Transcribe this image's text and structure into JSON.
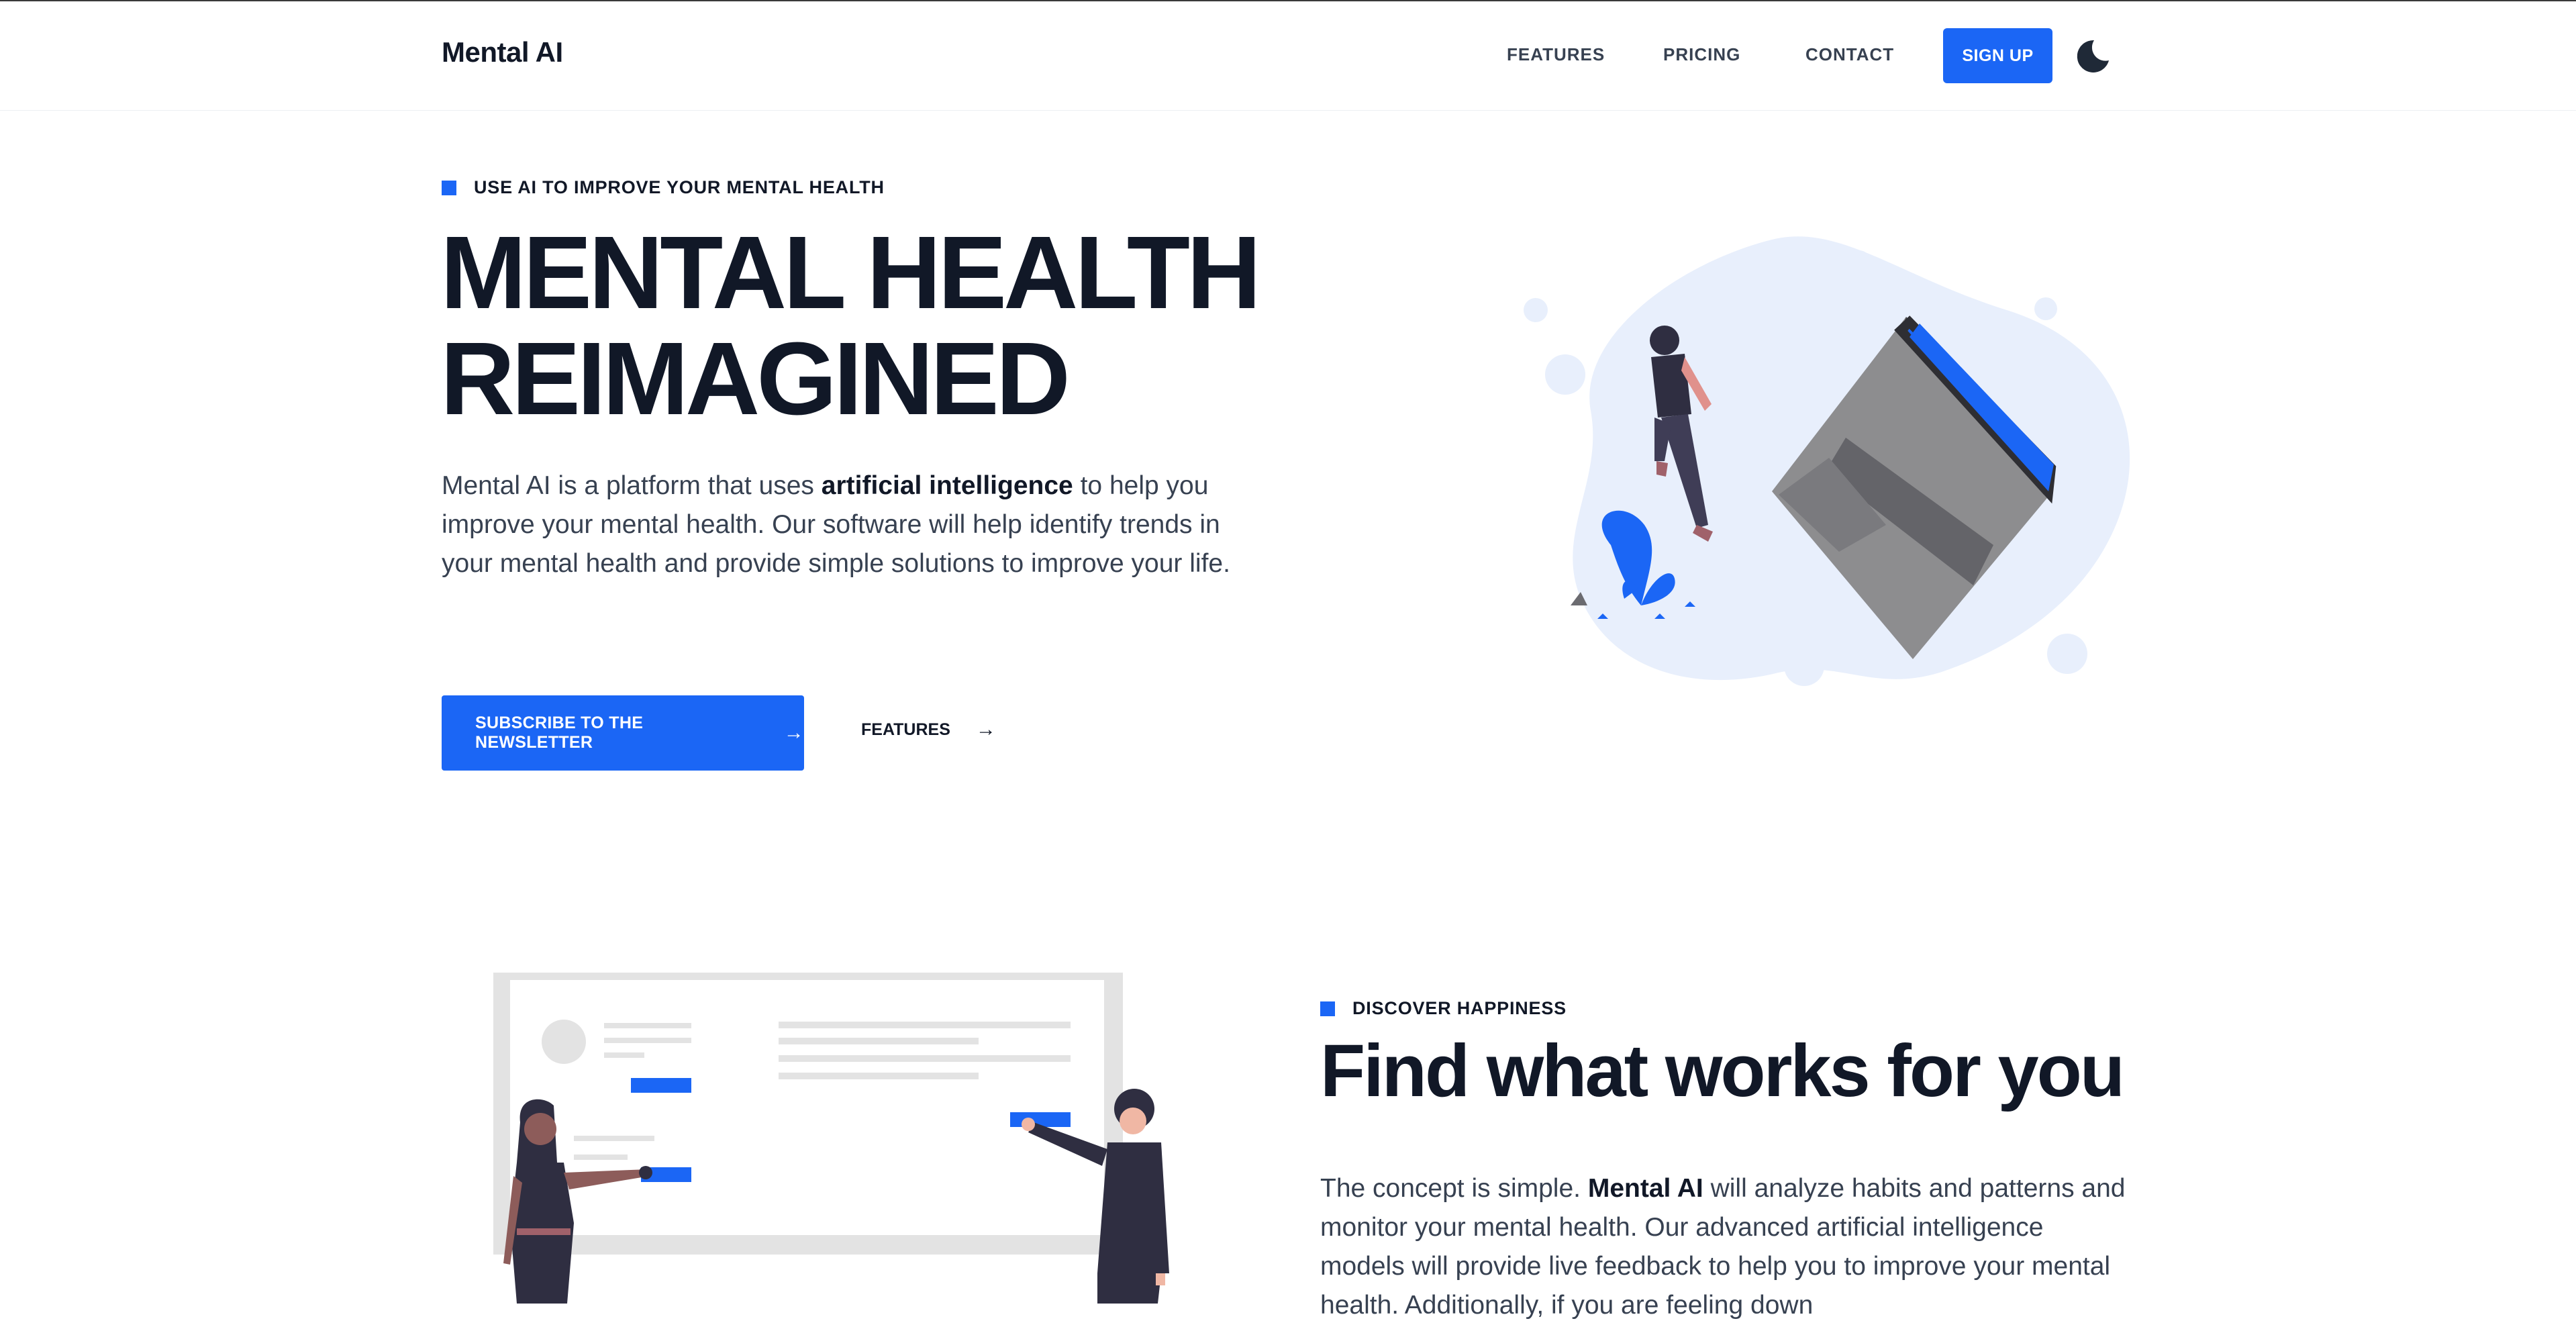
{
  "header": {
    "brand": "Mental AI",
    "nav": [
      "FEATURES",
      "PRICING",
      "CONTACT"
    ],
    "signup_label": "SIGN UP",
    "theme_toggle_icon": "moon-icon"
  },
  "hero": {
    "eyebrow": "USE AI TO IMPROVE YOUR MENTAL HEALTH",
    "title_line1": "MENTAL HEALTH",
    "title_line2": "REIMAGINED",
    "lead_before": "Mental AI is a platform that uses ",
    "lead_bold": "artificial intelligence",
    "lead_after": " to help you improve your mental health. Our software will help identify trends in your mental health and provide simple solutions to improve your life.",
    "subscribe_label": "SUBSCRIBE TO THE NEWSLETTER",
    "features_label": "FEATURES",
    "arrow": "→",
    "illustration_icon": "person-with-laptop-illustration"
  },
  "section": {
    "eyebrow": "DISCOVER HAPPINESS",
    "title": "Find what works for you",
    "body_before": "The concept is simple. ",
    "body_bold": "Mental AI",
    "body_after": " will analyze habits and patterns and monitor your mental health. Our advanced artificial intelligence models will provide live feedback to help you to improve your mental health. Additionally, if you are feeling down",
    "illustration_icon": "people-at-whiteboard-illustration"
  },
  "colors": {
    "accent": "#1b66f5",
    "text_dark": "#111827",
    "text_body": "#374151",
    "blob": "#e8effc"
  }
}
